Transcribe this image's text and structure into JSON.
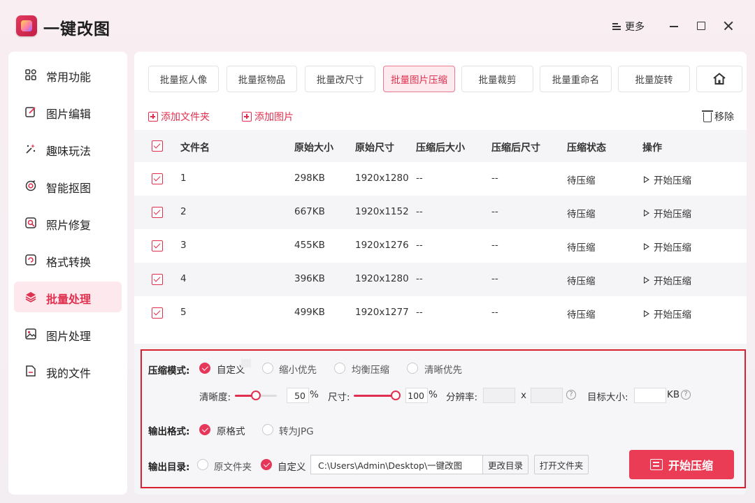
{
  "app": {
    "title": "一键改图"
  },
  "titlebar": {
    "more_label": "更多"
  },
  "sidebar": {
    "items": [
      {
        "label": "常用功能",
        "icon": "grid-icon",
        "active": false
      },
      {
        "label": "图片编辑",
        "icon": "edit-icon",
        "active": false
      },
      {
        "label": "趣味玩法",
        "icon": "sparkle-icon",
        "active": false
      },
      {
        "label": "智能抠图",
        "icon": "target-icon",
        "active": false
      },
      {
        "label": "照片修复",
        "icon": "repair-icon",
        "active": false
      },
      {
        "label": "格式转换",
        "icon": "convert-icon",
        "active": false
      },
      {
        "label": "批量处理",
        "icon": "layers-icon",
        "active": true
      },
      {
        "label": "图片处理",
        "icon": "image-icon",
        "active": false
      },
      {
        "label": "我的文件",
        "icon": "file-icon",
        "active": false
      }
    ]
  },
  "tabs": [
    {
      "label": "批量抠人像",
      "active": false
    },
    {
      "label": "批量抠物品",
      "active": false
    },
    {
      "label": "批量改尺寸",
      "active": false
    },
    {
      "label": "批量图片压缩",
      "active": true
    },
    {
      "label": "批量裁剪",
      "active": false
    },
    {
      "label": "批量重命名",
      "active": false
    },
    {
      "label": "批量旋转",
      "active": false
    }
  ],
  "toolbar": {
    "add_folder": "添加文件夹",
    "add_image": "添加图片",
    "remove": "移除"
  },
  "table": {
    "columns": [
      "文件名",
      "原始大小",
      "原始尺寸",
      "压缩后大小",
      "压缩后尺寸",
      "压缩状态",
      "操作"
    ],
    "rows": [
      {
        "name": "1",
        "orig_size": "298KB",
        "orig_dim": "1920x1280",
        "new_size": "--",
        "new_dim": "--",
        "status": "待压缩",
        "action": "开始压缩",
        "checked": true
      },
      {
        "name": "2",
        "orig_size": "667KB",
        "orig_dim": "1920x1152",
        "new_size": "--",
        "new_dim": "--",
        "status": "待压缩",
        "action": "开始压缩",
        "checked": true
      },
      {
        "name": "3",
        "orig_size": "455KB",
        "orig_dim": "1920x1276",
        "new_size": "--",
        "new_dim": "--",
        "status": "待压缩",
        "action": "开始压缩",
        "checked": true
      },
      {
        "name": "4",
        "orig_size": "396KB",
        "orig_dim": "1920x1280",
        "new_size": "--",
        "new_dim": "--",
        "status": "待压缩",
        "action": "开始压缩",
        "checked": true
      },
      {
        "name": "5",
        "orig_size": "499KB",
        "orig_dim": "1920x1277",
        "new_size": "--",
        "new_dim": "--",
        "status": "待压缩",
        "action": "开始压缩",
        "checked": true
      }
    ]
  },
  "settings": {
    "mode_label": "压缩模式:",
    "modes": [
      {
        "label": "自定义",
        "selected": true
      },
      {
        "label": "缩小优先",
        "selected": false
      },
      {
        "label": "均衡压缩",
        "selected": false
      },
      {
        "label": "清晰优先",
        "selected": false
      }
    ],
    "clarity_label": "清晰度:",
    "clarity_value": "50",
    "clarity_level": 0.5,
    "percent": "%",
    "size_label": "尺寸:",
    "size_value": "100",
    "size_level": 1.0,
    "resolution_label": "分辨率:",
    "resolution_x": "x",
    "target_label": "目标大小:",
    "target_unit": "KB",
    "help_glyph": "?",
    "format_label": "输出格式:",
    "formats": [
      {
        "label": "原格式",
        "selected": true
      },
      {
        "label": "转为JPG",
        "selected": false
      }
    ],
    "dir_label": "输出目录:",
    "dirs": [
      {
        "label": "原文件夹",
        "selected": false
      },
      {
        "label": "自定义",
        "selected": true
      }
    ],
    "dir_path": "C:\\Users\\Admin\\Desktop\\一键改图",
    "change_dir": "更改目录",
    "open_folder": "打开文件夹",
    "start": "开始压缩"
  },
  "colors": {
    "accent": "#e0304f",
    "button": "#ea3c54",
    "highlight_border": "#d8202e"
  }
}
